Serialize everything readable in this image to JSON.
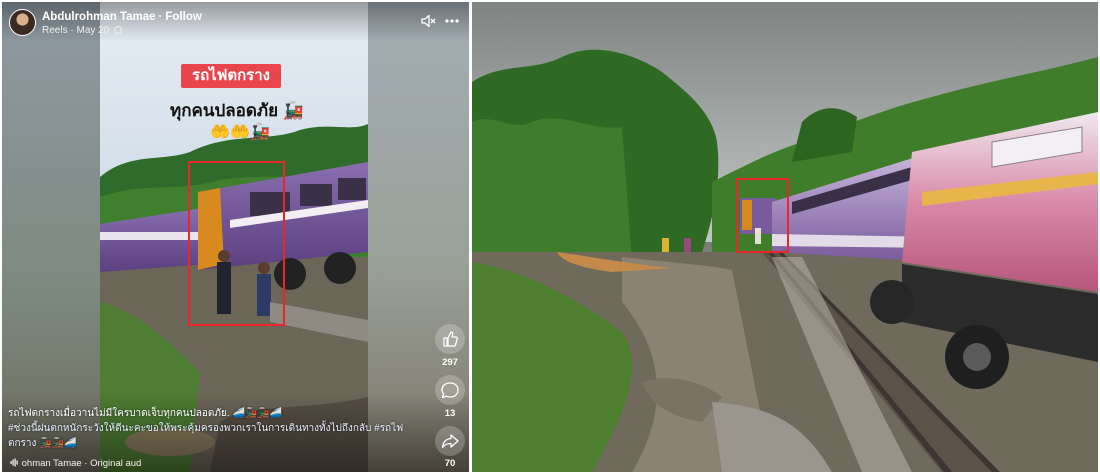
{
  "reel": {
    "author_name": "Abdulrohman Tamae",
    "separator": "·",
    "follow_label": "Follow",
    "source_label": "Reels",
    "date_label": "May 20",
    "title_badge": "รถไฟตกราง",
    "subtitle_text": "ทุกคนปลอดภัย",
    "subtitle_emoji": "🚂",
    "emoji_row": "🤲🤲🚂",
    "like_count": "297",
    "comment_count": "13",
    "share_count": "70",
    "caption_lead": "รถไฟตกรางเมื่อวานไม่มีใครบาดเจ็บทุกคนปลอดภัย.",
    "caption_lead_emoji": "🚄🚂🚂🚄",
    "caption_body": "#ช่วงนี้ฝนตกหนักระวังให้ดีนะคะขอให้พระคุ้มครองพวกเราในการเดินทางทั้งไปถึงกลับ #รถไฟตกราง",
    "caption_body_emoji": "🚂🚂🚄",
    "audio_label": "ohman Tamae · Original aud"
  },
  "colors": {
    "badge_red": "#e9454d",
    "highlight_red": "#e8262b",
    "train_purple": "#6e4f93",
    "train_orange": "#d98a1e",
    "foliage_green": "#3f7f2e"
  },
  "icons": [
    "avatar",
    "globe-icon",
    "mute-icon",
    "more-icon",
    "like-icon",
    "comment-icon",
    "share-icon",
    "audio-icon"
  ]
}
